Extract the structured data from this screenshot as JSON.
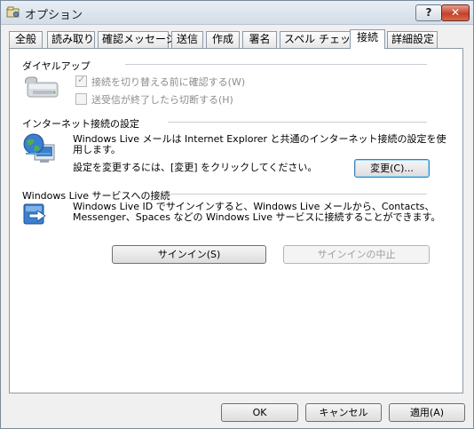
{
  "window": {
    "title": "オプション",
    "help_button": "?",
    "close_button": "✕"
  },
  "tabs": [
    {
      "label": "全般"
    },
    {
      "label": "読み取り"
    },
    {
      "label": "確認メッセージ"
    },
    {
      "label": "送信"
    },
    {
      "label": "作成"
    },
    {
      "label": "署名"
    },
    {
      "label": "スペル チェック"
    },
    {
      "label": "接続",
      "active": true
    },
    {
      "label": "詳細設定"
    }
  ],
  "dialup": {
    "title": "ダイヤルアップ",
    "checkbox1": {
      "label": "接続を切り替える前に確認する(W)",
      "checked": true,
      "enabled": false
    },
    "checkbox2": {
      "label": "送受信が終了したら切断する(H)",
      "checked": false,
      "enabled": false
    }
  },
  "internet": {
    "title": "インターネット接続の設定",
    "description": "Windows Live メールは Internet Explorer と共通のインターネット接続の設定を使用します。",
    "change_prompt": "設定を変更するには、[変更] をクリックしてください。",
    "change_button": "変更(C)..."
  },
  "live_services": {
    "title": "Windows Live サービスへの接続",
    "description": "Windows Live ID でサインインすると、Windows Live メールから、Contacts、Messenger、Spaces などの Windows Live サービスに接続することができます。",
    "signin_button": "サインイン(S)",
    "cancel_signin_button": "サインインの中止"
  },
  "footer": {
    "ok": "OK",
    "cancel": "キャンセル",
    "apply": "適用(A)"
  }
}
